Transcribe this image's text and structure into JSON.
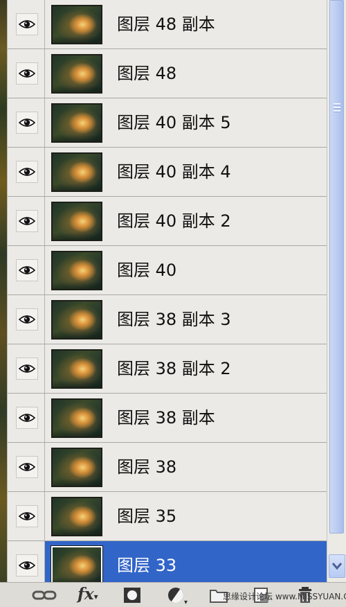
{
  "layers": [
    {
      "name": "图层 48 副本",
      "visible": true,
      "selected": false
    },
    {
      "name": "图层 48",
      "visible": true,
      "selected": false
    },
    {
      "name": "图层 40 副本 5",
      "visible": true,
      "selected": false
    },
    {
      "name": "图层 40 副本 4",
      "visible": true,
      "selected": false
    },
    {
      "name": "图层 40 副本 2",
      "visible": true,
      "selected": false
    },
    {
      "name": "图层 40",
      "visible": true,
      "selected": false
    },
    {
      "name": "图层 38 副本 3",
      "visible": true,
      "selected": false
    },
    {
      "name": "图层 38 副本 2",
      "visible": true,
      "selected": false
    },
    {
      "name": "图层 38 副本",
      "visible": true,
      "selected": false
    },
    {
      "name": "图层 38",
      "visible": true,
      "selected": false
    },
    {
      "name": "图层 35",
      "visible": true,
      "selected": false
    },
    {
      "name": "图层 33",
      "visible": true,
      "selected": true
    }
  ],
  "toolbar": {
    "buttons": [
      "link-layers-icon",
      "fx-icon",
      "add-mask-icon",
      "adjustment-layer-icon",
      "new-group-icon",
      "new-layer-icon",
      "delete-layer-icon"
    ],
    "fx_label": "fx"
  },
  "watermark": "思缘设计论坛 www.MISSYUAN.COM",
  "colors": {
    "selected_row": "#3265c8",
    "panel_bg": "#ebeae6"
  }
}
